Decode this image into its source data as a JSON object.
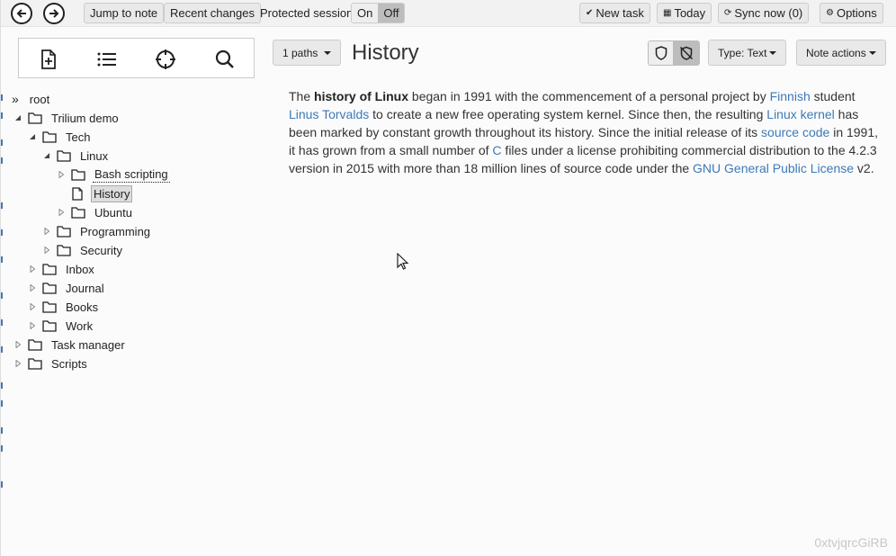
{
  "toolbar": {
    "jump_to_note": "Jump to note",
    "recent_changes": "Recent changes",
    "protected_session_label": "Protected session:",
    "protected_on": "On",
    "protected_off": "Off",
    "new_task": "New task",
    "today": "Today",
    "sync_now": "Sync now (0)",
    "options": "Options"
  },
  "tree": {
    "root": "root",
    "items": [
      {
        "label": "Trilium demo"
      },
      {
        "label": "Tech"
      },
      {
        "label": "Linux"
      },
      {
        "label": "Bash scripting"
      },
      {
        "label": "History"
      },
      {
        "label": "Ubuntu"
      },
      {
        "label": "Programming"
      },
      {
        "label": "Security"
      },
      {
        "label": "Inbox"
      },
      {
        "label": "Journal"
      },
      {
        "label": "Books"
      },
      {
        "label": "Work"
      },
      {
        "label": "Task manager"
      },
      {
        "label": "Scripts"
      }
    ]
  },
  "note": {
    "paths_button": "1 paths",
    "title": "History",
    "type_button": "Type: Text",
    "actions_button": "Note actions",
    "content": {
      "p1": "The ",
      "bold": "history of Linux",
      "p2": " began in 1991 with the commencement of a personal project by ",
      "l1": "Finnish",
      "p3": " student ",
      "l2": "Linus Torvalds",
      "p4": " to create a new free operating system kernel. Since then, the resulting ",
      "l3": "Linux kernel",
      "p5": " has been marked by constant growth throughout its history. Since the initial release of its ",
      "l4": "source code",
      "p6": " in 1991, it has grown from a small number of ",
      "l5": "C",
      "p7": " files under a license prohibiting commercial distribution to the 4.2.3 version in 2015 with more than 18 million lines of source code under the ",
      "l6": "GNU General Public License",
      "p8": " v2."
    },
    "note_id": "0xtvjqrcGiRB"
  },
  "colors": {
    "link": "#3d7ab8",
    "toolbar_bg": "#f2f2f2",
    "active_node_bg": "#dddddd"
  }
}
